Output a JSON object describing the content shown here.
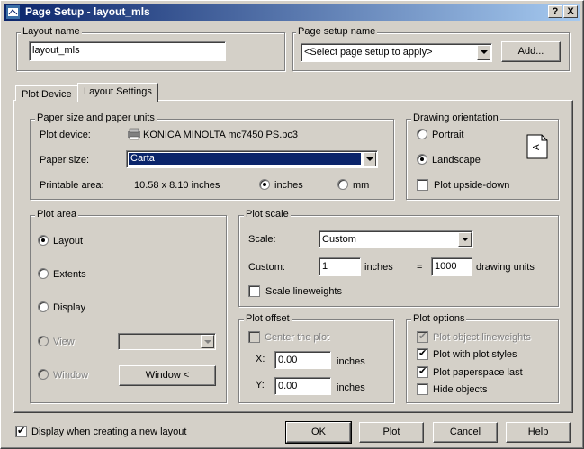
{
  "window": {
    "title": "Page Setup - layout_mls",
    "help_btn": "?",
    "close_btn": "X"
  },
  "layout_name": {
    "label": "Layout name",
    "value": "layout_mls"
  },
  "page_setup": {
    "label": "Page setup name",
    "value": "<Select page setup to apply>",
    "add_btn": "Add..."
  },
  "tabs": [
    {
      "label": "Plot Device"
    },
    {
      "label": "Layout Settings"
    }
  ],
  "paper": {
    "group": "Paper size and paper units",
    "device_label": "Plot device:",
    "device_value": "KONICA MINOLTA mc7450 PS.pc3",
    "size_label": "Paper size:",
    "size_value": "Carta",
    "printable_label": "Printable area:",
    "printable_value": "10.58 x 8.10 inches",
    "unit_inches": "inches",
    "unit_mm": "mm"
  },
  "orientation": {
    "group": "Drawing orientation",
    "portrait": "Portrait",
    "landscape": "Landscape",
    "upside": "Plot upside-down"
  },
  "plot_area": {
    "group": "Plot area",
    "layout": "Layout",
    "extents": "Extents",
    "display": "Display",
    "view": "View",
    "window": "Window",
    "window_btn": "Window <"
  },
  "plot_scale": {
    "group": "Plot scale",
    "scale_label": "Scale:",
    "scale_value": "Custom",
    "custom_label": "Custom:",
    "custom_value": "1",
    "inches": "inches",
    "equals": "=",
    "units_value": "1000",
    "units_label": "drawing units",
    "lineweights": "Scale lineweights"
  },
  "plot_offset": {
    "group": "Plot offset",
    "center": "Center the plot",
    "x_label": "X:",
    "x_value": "0.00",
    "y_label": "Y:",
    "y_value": "0.00",
    "inches": "inches"
  },
  "plot_options": {
    "group": "Plot options",
    "lineweights": "Plot object lineweights",
    "styles": "Plot with plot styles",
    "paperspace": "Plot paperspace last",
    "hide": "Hide objects"
  },
  "footer": {
    "display_check": "Display when creating a new layout",
    "ok": "OK",
    "plot": "Plot",
    "cancel": "Cancel",
    "help": "Help"
  },
  "colors": {
    "title_start": "#0a246a",
    "title_end": "#a6caf0",
    "selection": "#0a246a"
  }
}
